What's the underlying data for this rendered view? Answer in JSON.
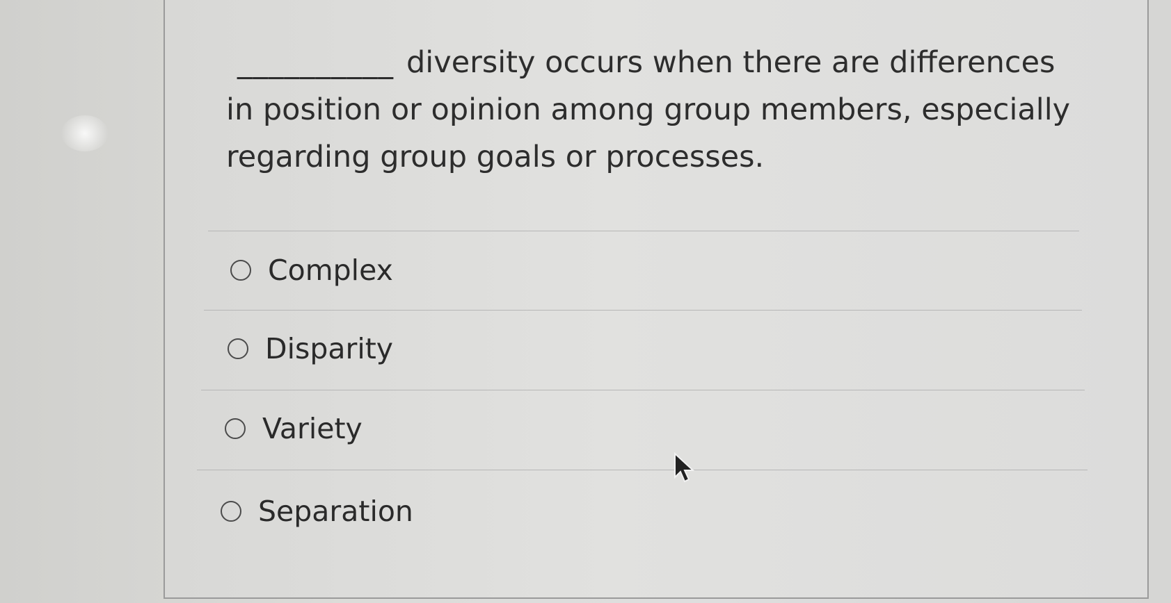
{
  "question": {
    "blank": "__________",
    "text": "diversity occurs when there are differences in position or opinion among group members, especially regarding group goals or processes."
  },
  "options": [
    {
      "label": "Complex",
      "icon": "radio-empty-icon"
    },
    {
      "label": "Disparity",
      "icon": "radio-empty-icon"
    },
    {
      "label": "Variety",
      "icon": "radio-empty-icon"
    },
    {
      "label": "Separation",
      "icon": "radio-empty-icon"
    }
  ],
  "cursor": {
    "icon": "mouse-pointer-icon"
  }
}
